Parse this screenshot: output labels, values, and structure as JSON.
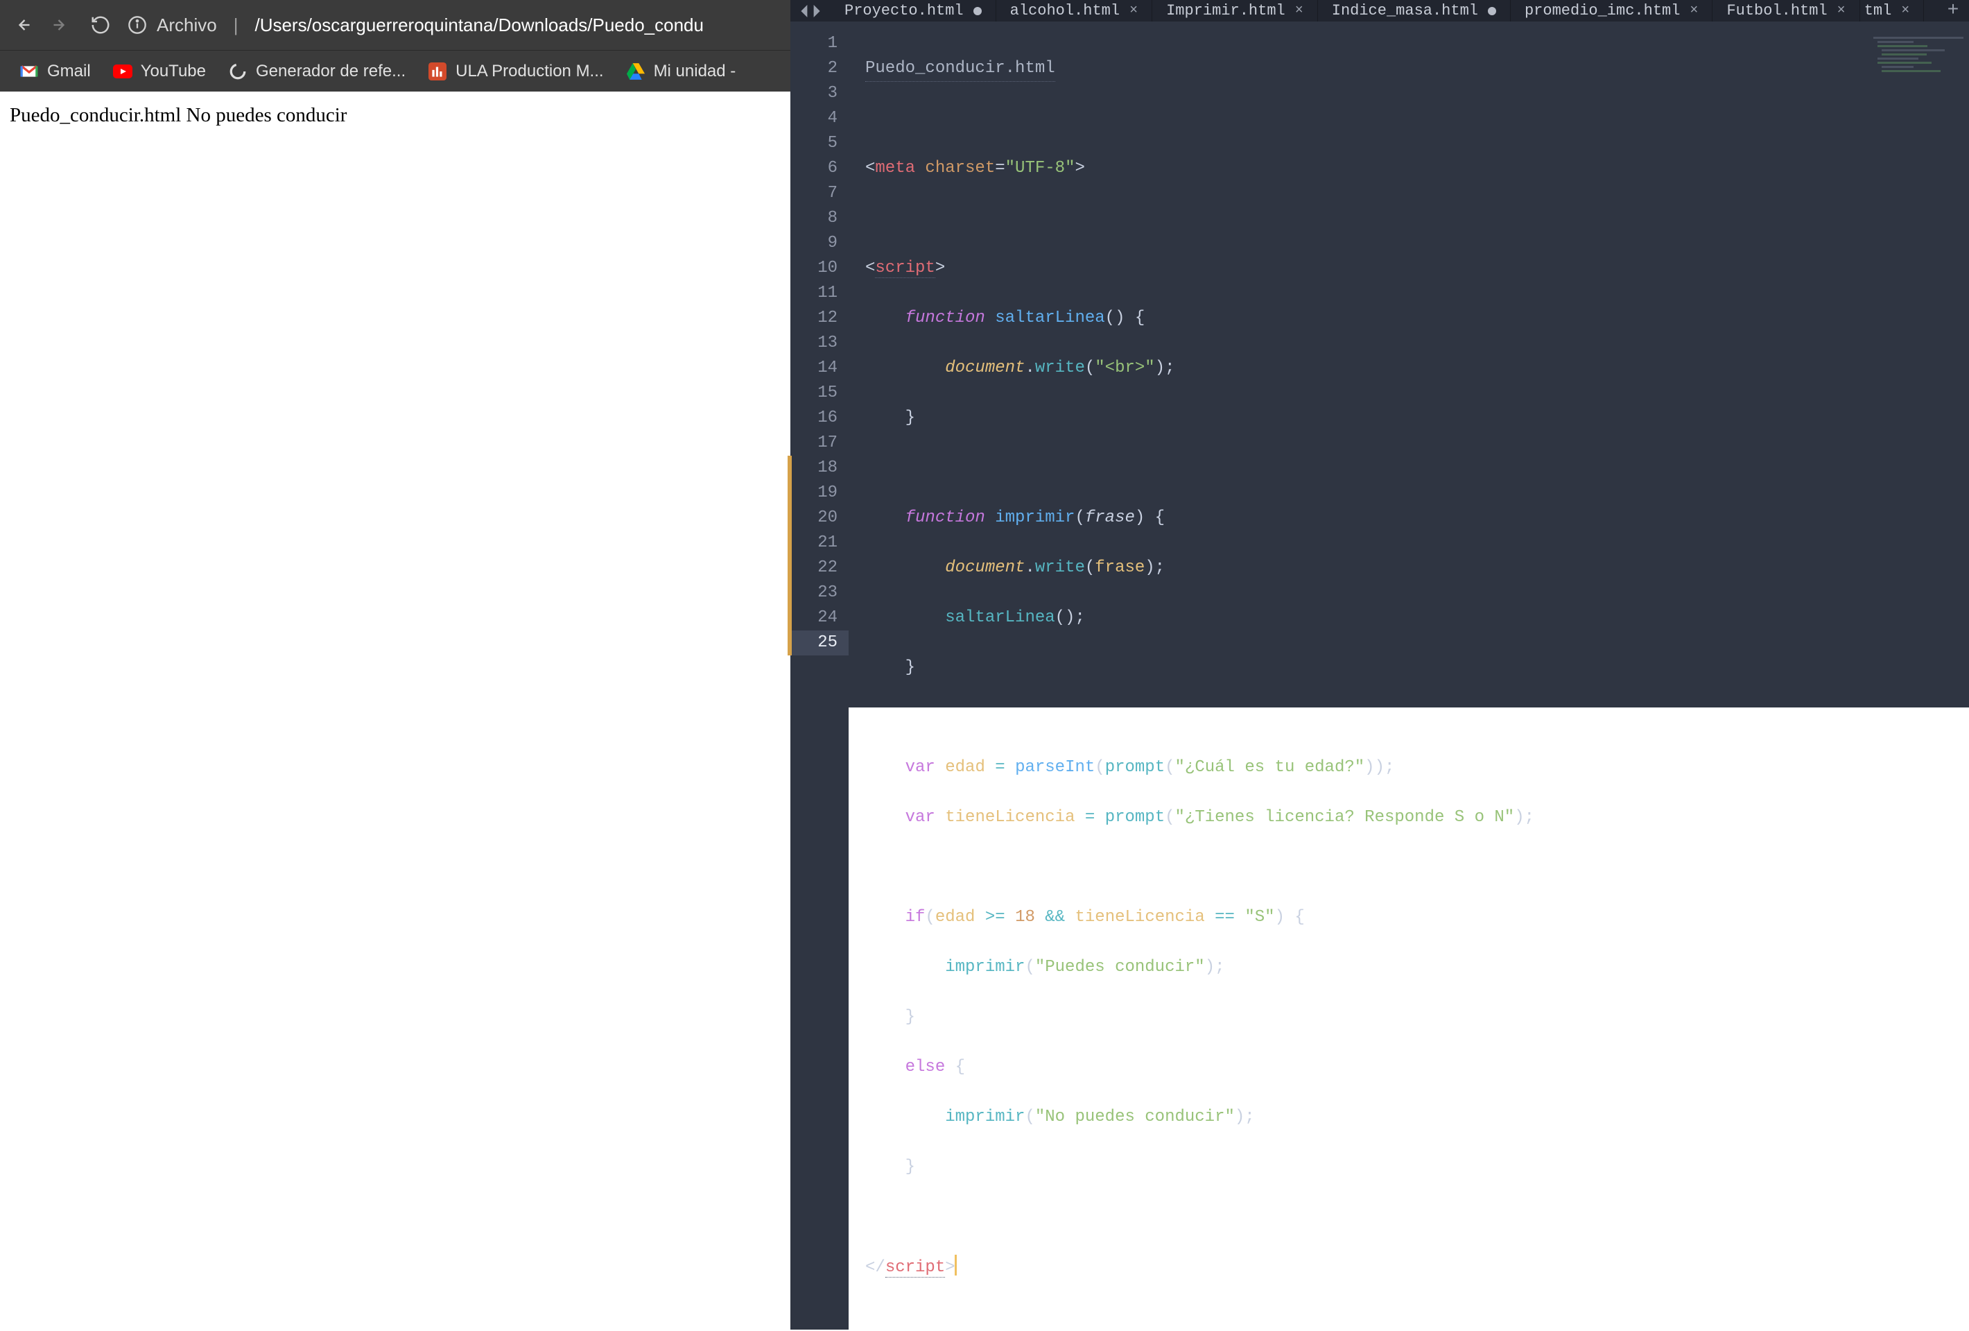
{
  "browser": {
    "address": {
      "scheme": "Archivo",
      "path": "/Users/oscarguerreroquintana/Downloads/Puedo_condu"
    },
    "bookmarks": [
      {
        "label": "Gmail",
        "icon": "gmail"
      },
      {
        "label": "YouTube",
        "icon": "youtube"
      },
      {
        "label": "Generador de refe...",
        "icon": "spinner"
      },
      {
        "label": "ULA Production M...",
        "icon": "ula"
      },
      {
        "label": "Mi unidad -",
        "icon": "drive"
      }
    ],
    "page_text": "Puedo_conducir.html No puedes conducir"
  },
  "editor": {
    "tabs": [
      {
        "label": "Proyecto.html",
        "state": "dirty"
      },
      {
        "label": "alcohol.html",
        "state": "clean"
      },
      {
        "label": "Imprimir.html",
        "state": "clean"
      },
      {
        "label": "Indice_masa.html",
        "state": "dirty"
      },
      {
        "label": "promedio_imc.html",
        "state": "clean"
      },
      {
        "label": "Futbol.html",
        "state": "clean"
      },
      {
        "label": "tml",
        "state": "clean",
        "partial": true
      }
    ],
    "filename": "Puedo_conducir.html",
    "line_count": 25,
    "active_line": 25,
    "modified_lines": [
      18,
      19,
      20,
      21,
      22,
      23,
      24,
      25
    ],
    "code": {
      "l3": {
        "charset": "\"UTF-8\""
      },
      "l6": {
        "fn": "saltarLinea"
      },
      "l7": {
        "arg": "\"<br>\""
      },
      "l9": {
        "fn": "imprimir",
        "param": "frase"
      },
      "l10": {
        "arg": "frase"
      },
      "l11": {
        "call": "saltarLinea"
      },
      "l14": {
        "var": "edad",
        "call": "parseInt",
        "inner": "prompt",
        "arg": "\"¿Cuál es tu edad?\""
      },
      "l15": {
        "var": "tieneLicencia",
        "call": "prompt",
        "arg": "\"¿Tienes licencia? Responde S o N\""
      },
      "l18": {
        "v1": "edad",
        "n": "18",
        "v2": "tieneLicencia",
        "s": "\"S\""
      },
      "l19": {
        "call": "imprimir",
        "arg": "\"Puedes conducir\""
      },
      "l22": {
        "call": "imprimir",
        "arg": "\"No puedes conducir\""
      }
    }
  }
}
